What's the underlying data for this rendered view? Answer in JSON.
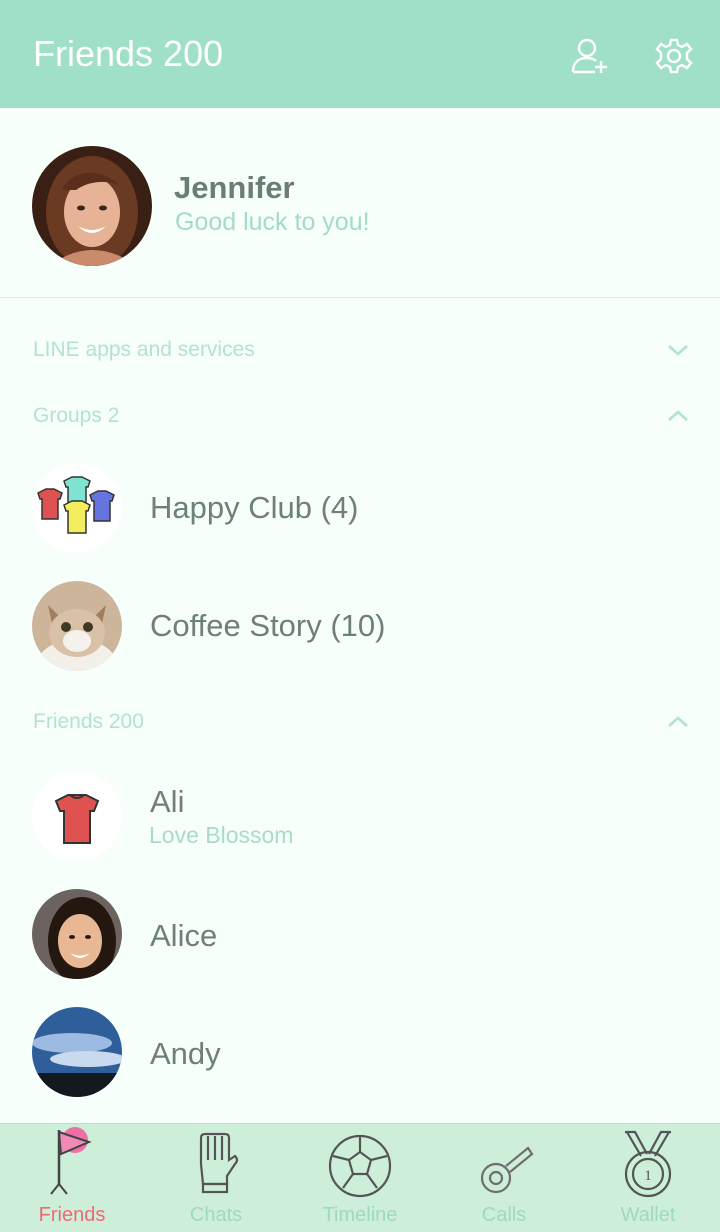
{
  "header": {
    "title": "Friends 200",
    "add_friend_icon": "add-person-icon",
    "settings_icon": "gear-icon"
  },
  "profile": {
    "name": "Jennifer",
    "status": "Good luck to you!"
  },
  "sections": {
    "services": {
      "label": "LINE apps and services",
      "state": "collapsed"
    },
    "groups": {
      "label": "Groups 2",
      "state": "expanded"
    },
    "friends": {
      "label": "Friends 200",
      "state": "expanded"
    }
  },
  "groups": [
    {
      "name": "Happy Club (4)",
      "icon": "jerseys-12-avatar"
    },
    {
      "name": "Coffee Story (10)",
      "icon": "cat-avatar"
    }
  ],
  "friends": [
    {
      "name": "Ali",
      "status": "Love Blossom",
      "icon": "jersey-10-avatar"
    },
    {
      "name": "Alice",
      "icon": "woman-photo-avatar"
    },
    {
      "name": "Andy",
      "icon": "sky-photo-avatar"
    }
  ],
  "tabs": [
    {
      "label": "Friends",
      "icon": "flag-icon",
      "active": true
    },
    {
      "label": "Chats",
      "icon": "glove-icon",
      "active": false
    },
    {
      "label": "Timeline",
      "icon": "soccer-ball-icon",
      "active": false
    },
    {
      "label": "Calls",
      "icon": "whistle-icon",
      "active": false
    },
    {
      "label": "Wallet",
      "icon": "medal-icon",
      "active": false,
      "badge_text": "1"
    }
  ],
  "colors": {
    "header": "#9fe0c6",
    "background": "#f6fff9",
    "tabbar": "#cdefd9",
    "active_tab": "#ee6a73",
    "accent_text": "#a3dcc6"
  }
}
